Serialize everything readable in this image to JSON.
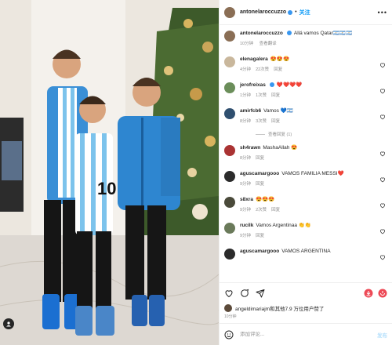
{
  "post": {
    "author": "antonelaroccuzzo",
    "follow_label": "关注",
    "more_label": "•••",
    "caption": {
      "user": "antonelaroccuzzo",
      "text": "Allá vamos Qatar🇦🇷🇦🇷🇦🇷",
      "time": "10分钟",
      "translate": "查看翻译"
    },
    "colors": {
      "accent": "#0095f6",
      "verified": "#3897f0",
      "like_red": "#ed4956"
    }
  },
  "comments": [
    {
      "user": "elenagalera",
      "text": "😍😍😍",
      "time": "4分钟",
      "likes": "22次赞",
      "reply": "回复",
      "avatar_color": "#c9b79c"
    },
    {
      "user": "jerofreixas",
      "verified": true,
      "text": "❤️❤️❤️❤️",
      "time": "1分钟",
      "likes": "1次赞",
      "reply": "回复",
      "avatar_color": "#6b8e5a"
    },
    {
      "user": "amirfcb6",
      "text": "Vamos 💙🇦🇷",
      "time": "8分钟",
      "likes": "3次赞",
      "reply": "回复",
      "avatar_color": "#2f4f6f",
      "view_replies": "查看回复 (1)"
    },
    {
      "user": "sh4rawn",
      "text": "MashaAllah 😍",
      "time": "8分钟",
      "likes": "",
      "reply": "回复",
      "avatar_color": "#a33"
    },
    {
      "user": "aguscamargooo",
      "text": "VAMOS FAMILIA MESSI❤️",
      "time": "9分钟",
      "likes": "",
      "reply": "回复",
      "avatar_color": "#2b2b2b"
    },
    {
      "user": "s8xra",
      "text": "😍😍😍",
      "time": "9分钟",
      "likes": "2次赞",
      "reply": "回复",
      "avatar_color": "#4a4a3a"
    },
    {
      "user": "rucilk",
      "text": "Vamos Argentinaa 👏👏",
      "time": "9分钟",
      "likes": "",
      "reply": "回复",
      "avatar_color": "#6a7a5a"
    },
    {
      "user": "aguscamargooo",
      "text": "VAMOS ARGENTINA",
      "time": "",
      "likes": "",
      "reply": "",
      "avatar_color": "#2b2b2b"
    }
  ],
  "likes_bar": {
    "text": "angeldimariajm和其他7.9 万位用户赞了",
    "time": "10分钟"
  },
  "composer": {
    "placeholder": "添加评论...",
    "post_label": "发布"
  },
  "icons": {
    "like": "heart-icon",
    "comment": "comment-icon",
    "share": "share-icon",
    "download": "download-icon",
    "save": "bookmark-icon",
    "tag": "person-tag-icon",
    "emoji": "emoji-icon"
  }
}
